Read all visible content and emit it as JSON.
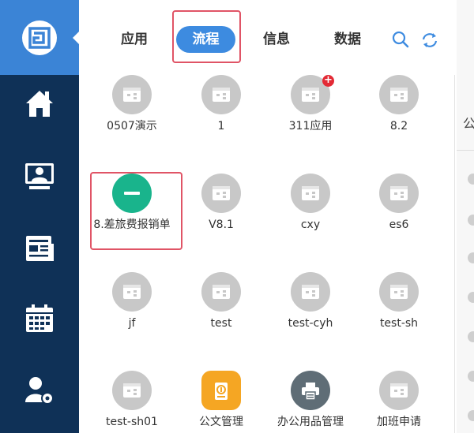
{
  "tabs": [
    {
      "label": "应用",
      "active": false
    },
    {
      "label": "流程",
      "active": true
    },
    {
      "label": "信息",
      "active": false
    },
    {
      "label": "数据",
      "active": false
    }
  ],
  "toolbar": {
    "search_icon": "search-icon",
    "refresh_icon": "refresh-icon"
  },
  "sidebar": {
    "logo_icon": "app-logo-icon",
    "items": [
      {
        "icon": "home-icon"
      },
      {
        "icon": "monitor-user-icon"
      },
      {
        "icon": "news-icon"
      },
      {
        "icon": "calendar-icon"
      },
      {
        "icon": "user-settings-icon"
      }
    ]
  },
  "apps": [
    {
      "label": "0507演示",
      "icon": "workflow-icon"
    },
    {
      "label": "1",
      "icon": "workflow-icon"
    },
    {
      "label": "311应用",
      "icon": "workflow-icon",
      "badge": "+"
    },
    {
      "label": "8.2",
      "icon": "workflow-icon"
    },
    {
      "label": "8.差旅费报销单",
      "icon": "minus-icon"
    },
    {
      "label": "V8.1",
      "icon": "workflow-icon"
    },
    {
      "label": "cxy",
      "icon": "workflow-icon"
    },
    {
      "label": "es6",
      "icon": "workflow-icon"
    },
    {
      "label": "jf",
      "icon": "workflow-icon"
    },
    {
      "label": "test",
      "icon": "workflow-icon"
    },
    {
      "label": "test-cyh",
      "icon": "workflow-icon"
    },
    {
      "label": "test-sh",
      "icon": "workflow-icon"
    },
    {
      "label": "test-sh01",
      "icon": "workflow-icon"
    },
    {
      "label": "公文管理",
      "icon": "document-seal-icon"
    },
    {
      "label": "办公用品管理",
      "icon": "printer-icon"
    },
    {
      "label": "加班申请",
      "icon": "workflow-icon"
    }
  ],
  "right_panel": {
    "text": "公"
  },
  "colors": {
    "sidebar": "#0f3157",
    "logo_bg": "#3b84d6",
    "active_tab": "#3d8be0",
    "highlight": "#e05466",
    "app_icon_gray": "#c8c8c8",
    "green": "#19b48c",
    "orange": "#f5a623",
    "dark_gray": "#5f6d76",
    "badge_red": "#e32a35"
  }
}
